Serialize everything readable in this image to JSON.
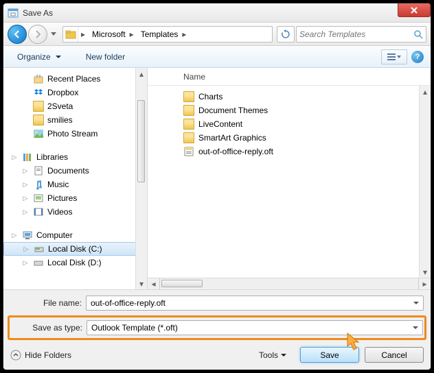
{
  "title": "Save As",
  "breadcrumb": [
    "Microsoft",
    "Templates"
  ],
  "search_placeholder": "Search Templates",
  "toolbar": {
    "organize": "Organize",
    "newfolder": "New folder"
  },
  "right_header": "Name",
  "left_tree": {
    "recent": "Recent Places",
    "dropbox": "Dropbox",
    "sveta": "2Sveta",
    "smilies": "smilies",
    "photo": "Photo Stream",
    "libraries": "Libraries",
    "documents": "Documents",
    "music": "Music",
    "pictures": "Pictures",
    "videos": "Videos",
    "computer": "Computer",
    "diskc": "Local Disk (C:)",
    "diskd": "Local Disk (D:)"
  },
  "right_items": {
    "charts": "Charts",
    "themes": "Document Themes",
    "live": "LiveContent",
    "smartart": "SmartArt Graphics",
    "oft": "out-of-office-reply.oft"
  },
  "footer": {
    "filename_label": "File name:",
    "filename_value": "out-of-office-reply.oft",
    "savetype_label": "Save as type:",
    "savetype_value": "Outlook Template (*.oft)",
    "hide_folders": "Hide Folders",
    "tools": "Tools",
    "save": "Save",
    "cancel": "Cancel"
  }
}
